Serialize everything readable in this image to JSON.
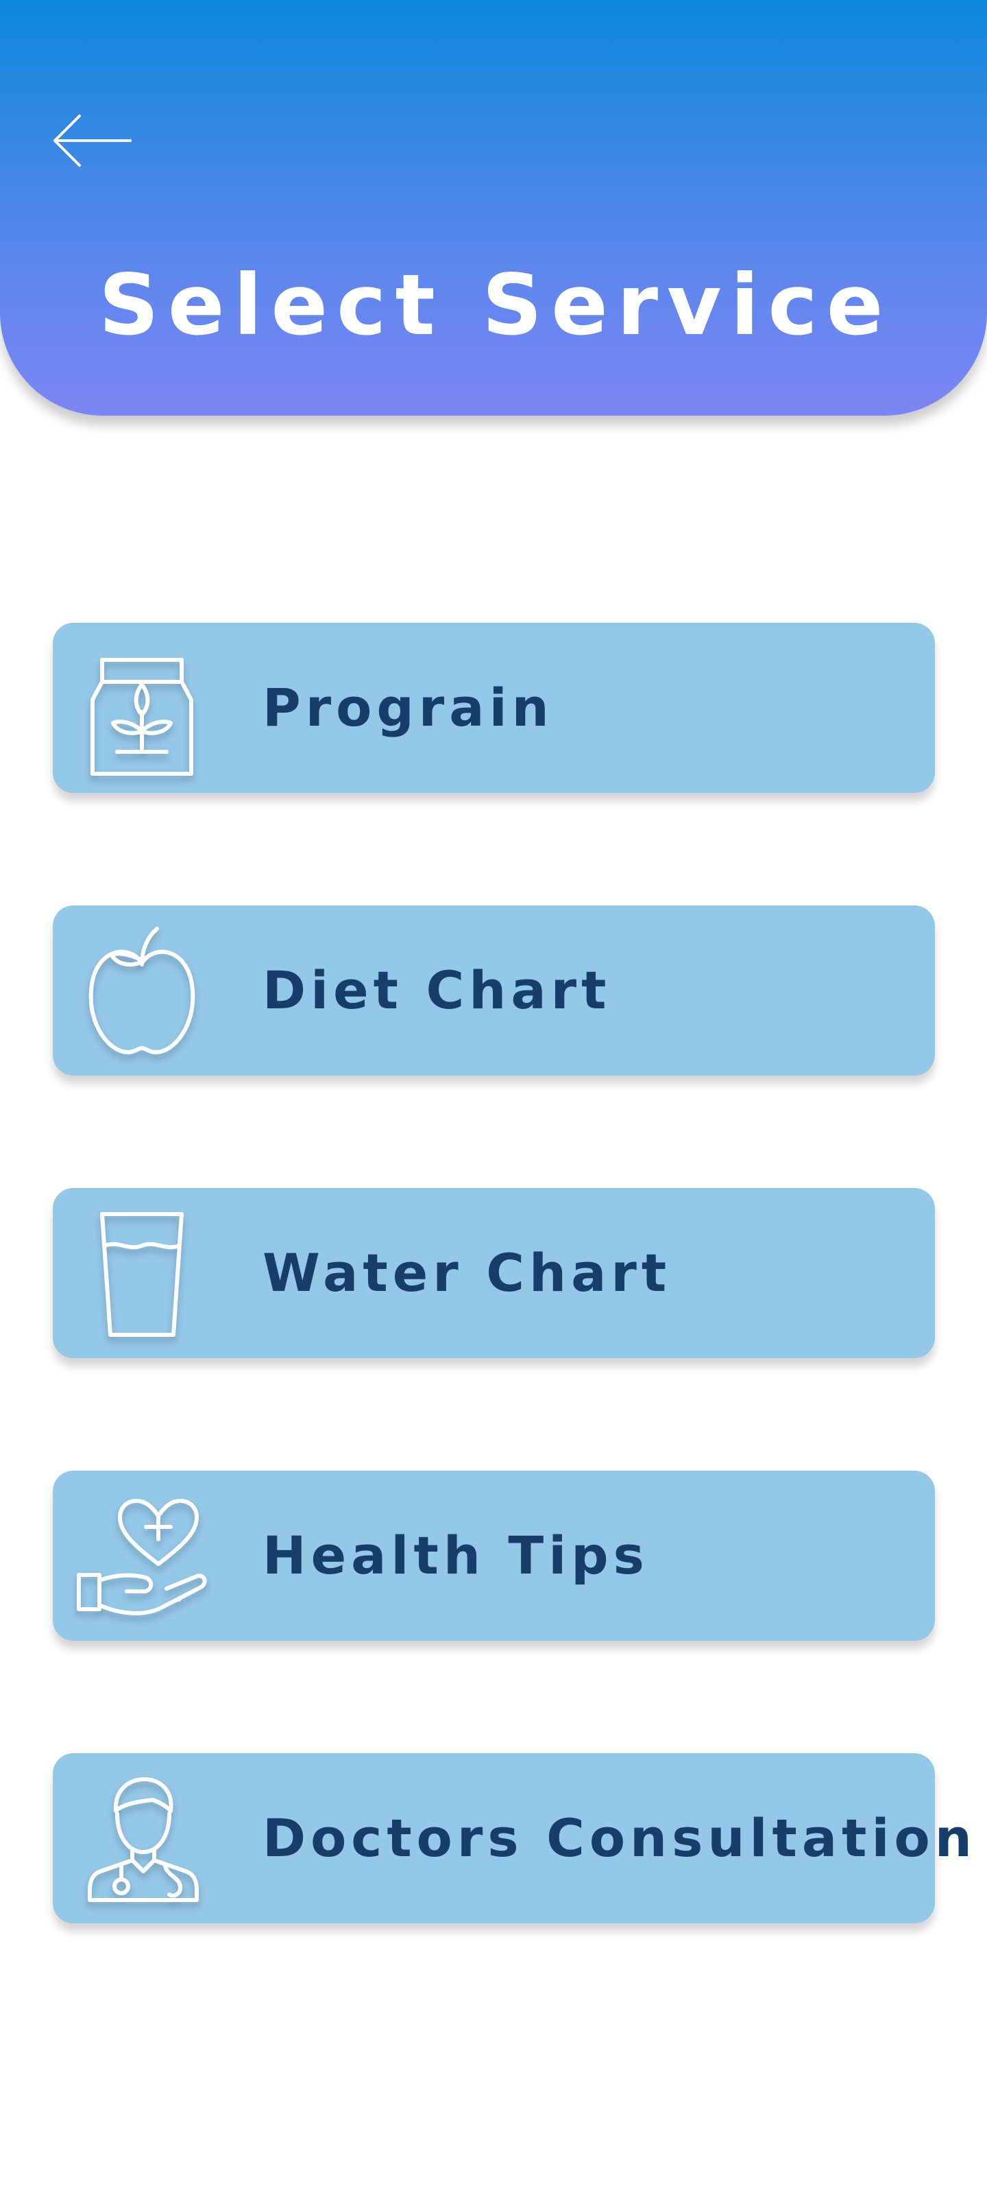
{
  "header": {
    "title": "Select Service",
    "background_gradient": [
      "#0b89db",
      "#7c86f3"
    ]
  },
  "services": [
    {
      "label": "Prograin",
      "icon": "seed-package-icon"
    },
    {
      "label": "Diet Chart",
      "icon": "apple-icon"
    },
    {
      "label": "Water Chart",
      "icon": "water-glass-icon"
    },
    {
      "label": "Health Tips",
      "icon": "heart-hand-icon"
    },
    {
      "label": "Doctors Consultation",
      "icon": "doctor-icon"
    }
  ],
  "colors": {
    "card_background": "#94c8e9",
    "label_text": "#173e68",
    "icon_stroke": "#ffffff"
  }
}
